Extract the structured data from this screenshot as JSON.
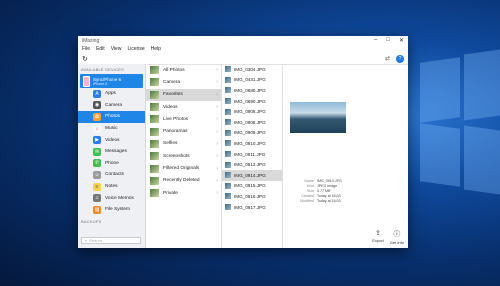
{
  "window": {
    "title": "iMazing"
  },
  "menu": [
    "File",
    "Edit",
    "View",
    "License",
    "Help"
  ],
  "sidebar": {
    "section_devices": "AVAILABLE DEVICES",
    "device": {
      "name": "Sync/Phone 6",
      "sub": "iPhone 6"
    },
    "items": [
      {
        "label": "Apps",
        "color": "#2b7de9",
        "icon": "A"
      },
      {
        "label": "Camera",
        "color": "#555555",
        "icon": "◉"
      },
      {
        "label": "Photos",
        "color": "#f2a23a",
        "icon": "✿"
      },
      {
        "label": "Music",
        "color": "#f8f8f8",
        "icon": "♪"
      },
      {
        "label": "Videos",
        "color": "#2b7de9",
        "icon": "▶"
      },
      {
        "label": "Messages",
        "color": "#3fbf4b",
        "icon": "✉"
      },
      {
        "label": "Phone",
        "color": "#3fbf4b",
        "icon": "✆"
      },
      {
        "label": "Contacts",
        "color": "#9a9a9a",
        "icon": "☺"
      },
      {
        "label": "Notes",
        "color": "#f6d34a",
        "icon": "≡"
      },
      {
        "label": "Voice Memos",
        "color": "#777777",
        "icon": "♫"
      },
      {
        "label": "File System",
        "color": "#f08a24",
        "icon": "▤"
      }
    ],
    "section_backups": "BACKUPS",
    "search_placeholder": "Search"
  },
  "albums": [
    "All Photos",
    "Camera",
    "Favorites",
    "Videos",
    "Live Photos",
    "Panoramas",
    "Selfies",
    "Screenshots",
    "Filtered Originals",
    "Recently Deleted",
    "Private"
  ],
  "files": [
    "IMG_0304.JPG",
    "IMG_0431.JPG",
    "IMG_0680.JPG",
    "IMG_0690.JPG",
    "IMG_0906.JPG",
    "IMG_0908.JPG",
    "IMG_0909.JPG",
    "IMG_0910.JPG",
    "IMG_0911.JPG",
    "IMG_0913.JPG",
    "IMG_0914.JPG",
    "IMG_0915.JPG",
    "IMG_0916.JPG",
    "IMG_0917.JPG"
  ],
  "details": {
    "name_label": "Name",
    "name": "IMG_0914.JPG",
    "kind_label": "Kind",
    "kind": "JPEG image",
    "size_label": "Size",
    "size": "3.77 MB",
    "created_label": "Created",
    "created": "Today at 16:03",
    "modified_label": "Modified",
    "modified": "Today at 16:03"
  },
  "actions": {
    "export": "Export",
    "get_info": "Get Info"
  },
  "accent": "#1f86e8"
}
